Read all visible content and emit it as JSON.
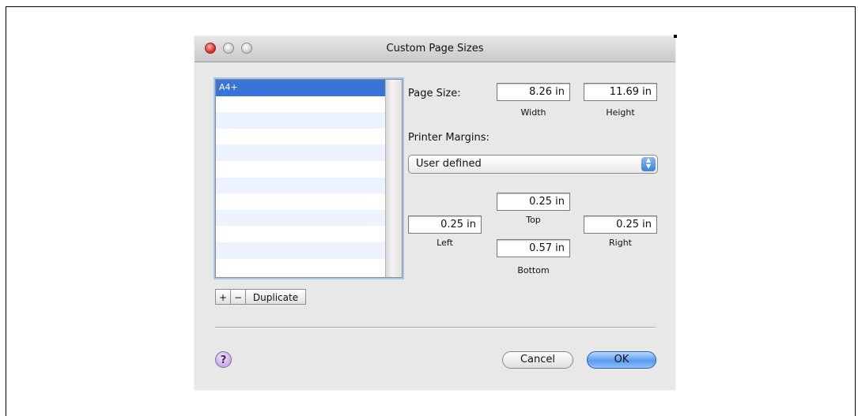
{
  "window": {
    "title": "Custom Page Sizes"
  },
  "list": {
    "items": [
      "A4+",
      "",
      "",
      "",
      "",
      "",
      "",
      "",
      "",
      "",
      "",
      ""
    ]
  },
  "list_buttons": {
    "add": "+",
    "remove": "−",
    "duplicate": "Duplicate"
  },
  "page_size": {
    "label": "Page Size:",
    "width_value": "8.26 in",
    "width_label": "Width",
    "height_value": "11.69 in",
    "height_label": "Height"
  },
  "margins": {
    "label": "Printer Margins:",
    "popup_value": "User defined",
    "top_value": "0.25 in",
    "top_label": "Top",
    "left_value": "0.25 in",
    "left_label": "Left",
    "right_value": "0.25 in",
    "right_label": "Right",
    "bottom_value": "0.57 in",
    "bottom_label": "Bottom"
  },
  "footer": {
    "help": "?",
    "cancel": "Cancel",
    "ok": "OK"
  }
}
